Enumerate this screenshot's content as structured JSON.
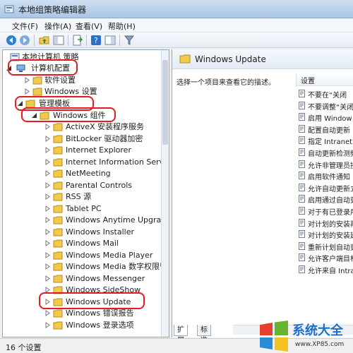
{
  "window": {
    "title": "本地组策略编辑器"
  },
  "menu": [
    "文件(F)",
    "操作(A)",
    "查看(V)",
    "帮助(H)"
  ],
  "tree": {
    "root": "本地计算机 策略",
    "computer_config": "计算机配置",
    "software_settings": "软件设置",
    "windows_settings": "Windows 设置",
    "admin_templates": "管理模板",
    "windows_components": "Windows 组件",
    "components": [
      "ActiveX 安装程序服务",
      "BitLocker 驱动器加密",
      "Internet Explorer",
      "Internet Information Services",
      "NetMeeting",
      "Parental Controls",
      "RSS 源",
      "Tablet PC",
      "Windows Anytime Upgrade",
      "Windows Installer",
      "Windows Mail",
      "Windows Media Player",
      "Windows Media 数字权限管理",
      "Windows Messenger",
      "Windows SideShow",
      "Windows Update",
      "Windows 错误报告",
      "Windows 登录选项"
    ]
  },
  "right": {
    "title": "Windows Update",
    "description": "选择一个项目来查看它的描述。",
    "column_header": "设置",
    "settings": [
      "不要在“关闭",
      "不要调整“关闭",
      "启用 Window",
      "配置自动更新",
      "指定 Intranet",
      "自动更新检测频",
      "允许非管理员接",
      "启用软件通知",
      "允许自动更新立",
      "启用通过自动更",
      "对于有已登录用",
      "对计划的安装再",
      "对计划的安装延",
      "重新计划自动更",
      "允许客户端目标",
      "允许来自 Intra"
    ],
    "tabs": [
      "扩展",
      "标准"
    ]
  },
  "status": "16 个设置",
  "watermark": {
    "brand": "系统大全",
    "url": "www.XP85.com"
  },
  "colors": {
    "highlight": "#e31b23",
    "folder": "#f2c94c"
  }
}
